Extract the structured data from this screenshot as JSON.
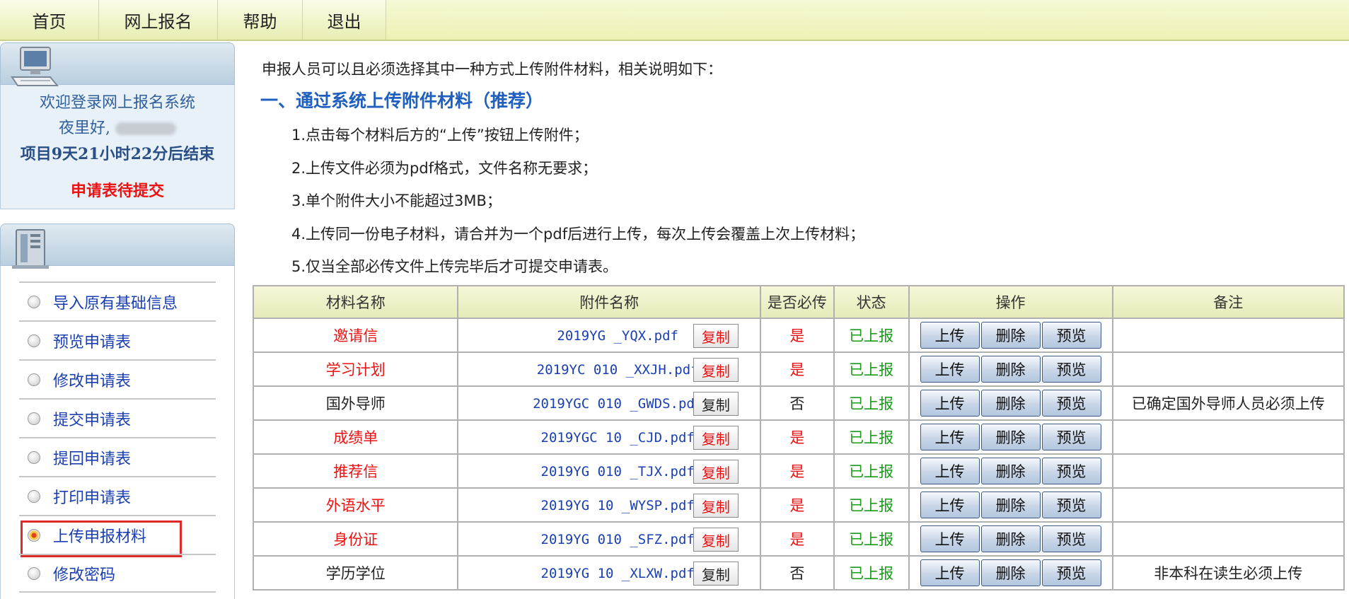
{
  "nav": {
    "items": [
      "首页",
      "网上报名",
      "帮助",
      "退出"
    ]
  },
  "sidebar": {
    "welcome_title": "欢迎登录网上报名系统",
    "greeting": "夜里好,",
    "countdown": "项目9天21小时22分后结束",
    "status": "申请表待提交",
    "menu": [
      "导入原有基础信息",
      "预览申请表",
      "修改申请表",
      "提交申请表",
      "提回申请表",
      "打印申请表",
      "上传申报材料",
      "修改密码"
    ],
    "active_menu": "上传申报材料"
  },
  "main": {
    "intro": "申报人员可以且必须选择其中一种方式上传附件材料，相关说明如下：",
    "section_title": "一、通过系统上传附件材料（推荐）",
    "rules": [
      "1.点击每个材料后方的“上传”按钮上传附件；",
      "2.上传文件必须为pdf格式，文件名称无要求；",
      "3.单个附件大小不能超过3MB；",
      "4.上传同一份电子材料，请合并为一个pdf后进行上传，每次上传会覆盖上次上传材料；",
      "5.仅当全部必传文件上传完毕后才可提交申请表。"
    ],
    "table": {
      "headers": [
        "材料名称",
        "附件名称",
        "是否必传",
        "状态",
        "操作",
        "备注"
      ],
      "copy_label": "复制",
      "op_labels": [
        "上传",
        "删除",
        "预览"
      ],
      "rows": [
        {
          "name": "邀请信",
          "file": "2019YG       _YQX.pdf",
          "required": "是",
          "status": "已上报",
          "note": ""
        },
        {
          "name": "学习计划",
          "file": "2019YC  010   _XXJH.pdf",
          "required": "是",
          "status": "已上报",
          "note": ""
        },
        {
          "name": "国外导师",
          "file": "2019YGC   010   _GWDS.pdf",
          "required": "否",
          "status": "已上报",
          "note": "已确定国外导师人员必须上传"
        },
        {
          "name": "成绩单",
          "file": "2019YGC   10   _CJD.pdf",
          "required": "是",
          "status": "已上报",
          "note": ""
        },
        {
          "name": "推荐信",
          "file": "2019YG   010   _TJX.pdf",
          "required": "是",
          "status": "已上报",
          "note": ""
        },
        {
          "name": "外语水平",
          "file": "2019YG    10   _WYSP.pdf",
          "required": "是",
          "status": "已上报",
          "note": ""
        },
        {
          "name": "身份证",
          "file": "2019YG   010   _SFZ.pdf",
          "required": "是",
          "status": "已上报",
          "note": ""
        },
        {
          "name": "学历学位",
          "file": "2019YG    10   _XLXW.pdf",
          "required": "否",
          "status": "已上报",
          "note": "非本科在读生必须上传"
        }
      ]
    }
  },
  "colors": {
    "required_red": "#ee1111",
    "status_green": "#1a9a1a",
    "link_blue": "#1a3fb3",
    "title_blue": "#1f5fbf"
  },
  "icons": {
    "welcome": "computer-icon",
    "menu": "server-icon",
    "radio": "radio-bullet-icon"
  }
}
